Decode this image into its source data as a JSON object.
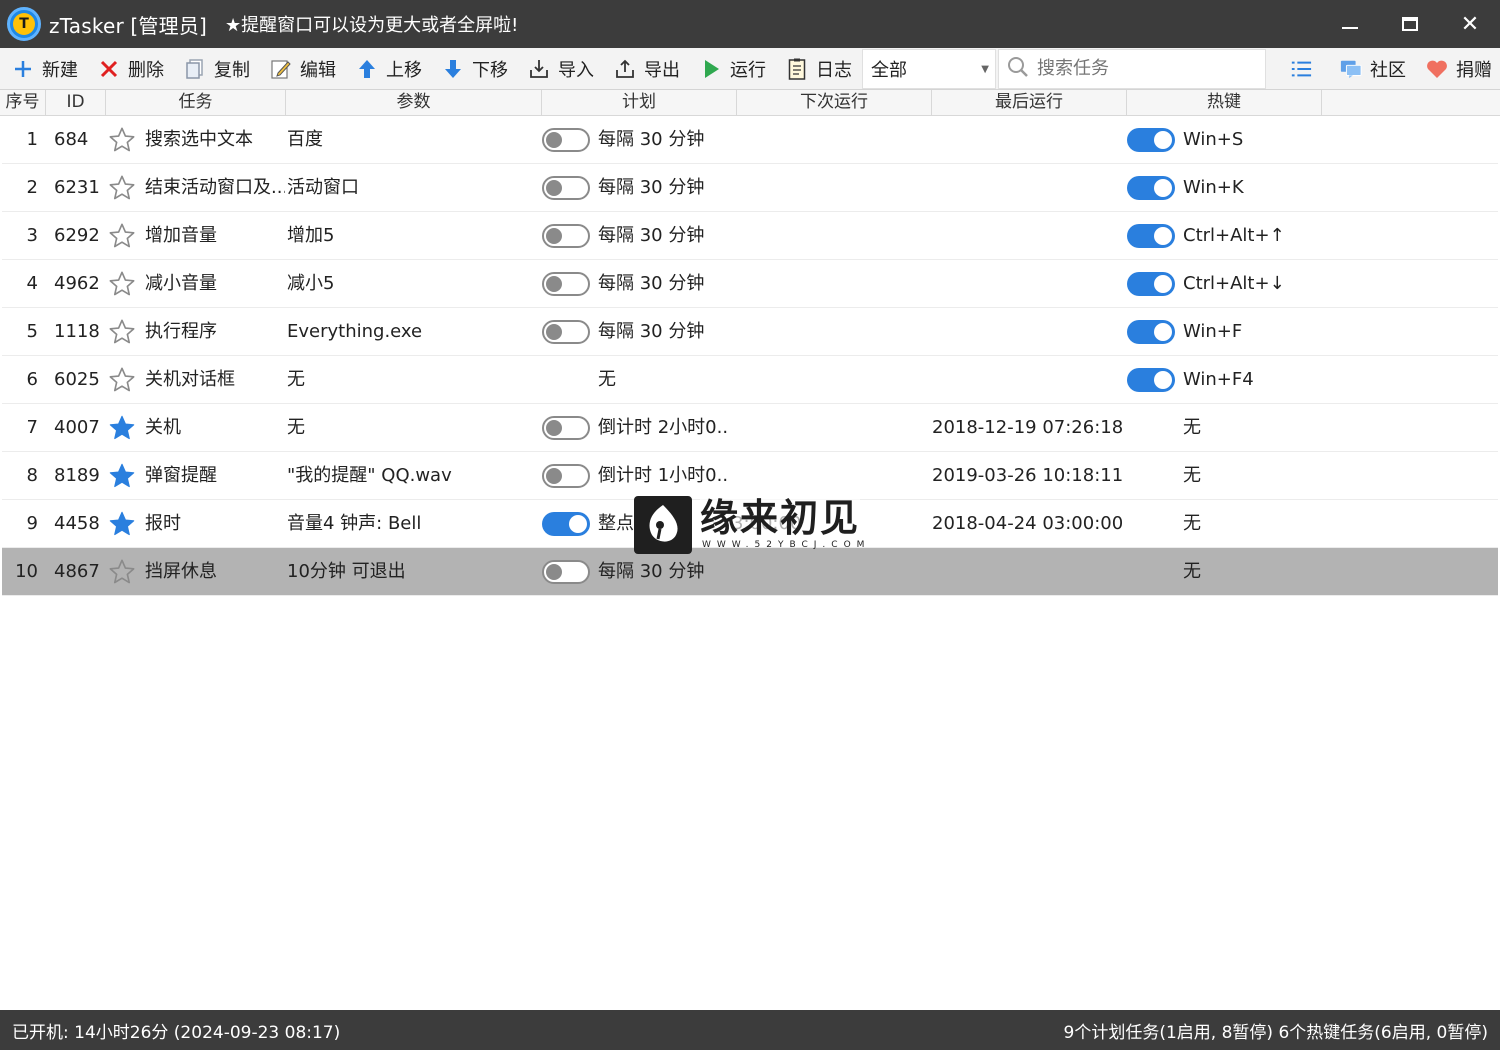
{
  "titlebar": {
    "logo_letter": "T",
    "title": "zTasker [管理员]",
    "notice": "★提醒窗口可以设为更大或者全屏啦!",
    "close_glyph": "✕"
  },
  "toolbar": {
    "new_label": "新建",
    "delete_label": "删除",
    "copy_label": "复制",
    "edit_label": "编辑",
    "move_up_label": "上移",
    "move_down_label": "下移",
    "import_label": "导入",
    "export_label": "导出",
    "run_label": "运行",
    "log_label": "日志",
    "filter_value": "全部",
    "search_placeholder": "搜索任务",
    "community_label": "社区",
    "donate_label": "捐赠"
  },
  "columns": {
    "seq": "序号",
    "id": "ID",
    "task": "任务",
    "param": "参数",
    "plan": "计划",
    "next_run": "下次运行",
    "last_run": "最后运行",
    "hotkey": "热键"
  },
  "rows": [
    {
      "seq": "1",
      "id": "684",
      "starred": false,
      "task": "搜索选中文本",
      "param": "百度",
      "plan_toggle": "off",
      "plan": "每隔 30 分钟",
      "next_run": "",
      "last_run": "",
      "hotkey_toggle": "on",
      "hotkey": "Win+S"
    },
    {
      "seq": "2",
      "id": "6231",
      "starred": false,
      "task": "结束活动窗口及...",
      "param": "活动窗口",
      "plan_toggle": "off",
      "plan": "每隔 30 分钟",
      "next_run": "",
      "last_run": "",
      "hotkey_toggle": "on",
      "hotkey": "Win+K"
    },
    {
      "seq": "3",
      "id": "6292",
      "starred": false,
      "task": "增加音量",
      "param": "增加5",
      "plan_toggle": "off",
      "plan": "每隔 30 分钟",
      "next_run": "",
      "last_run": "",
      "hotkey_toggle": "on",
      "hotkey": "Ctrl+Alt+↑"
    },
    {
      "seq": "4",
      "id": "4962",
      "starred": false,
      "task": "减小音量",
      "param": "减小5",
      "plan_toggle": "off",
      "plan": "每隔 30 分钟",
      "next_run": "",
      "last_run": "",
      "hotkey_toggle": "on",
      "hotkey": "Ctrl+Alt+↓"
    },
    {
      "seq": "5",
      "id": "1118",
      "starred": false,
      "task": "执行程序",
      "param": "Everything.exe",
      "plan_toggle": "off",
      "plan": "每隔 30 分钟",
      "next_run": "",
      "last_run": "",
      "hotkey_toggle": "on",
      "hotkey": "Win+F"
    },
    {
      "seq": "6",
      "id": "6025",
      "starred": false,
      "task": "关机对话框",
      "param": "无",
      "plan_toggle": "none",
      "plan": "无",
      "next_run": "",
      "last_run": "",
      "hotkey_toggle": "on",
      "hotkey": "Win+F4"
    },
    {
      "seq": "7",
      "id": "4007",
      "starred": true,
      "task": "关机",
      "param": "无",
      "plan_toggle": "off",
      "plan": "倒计时 2小时0...",
      "next_run": "",
      "last_run": "2018-12-19 07:26:18",
      "hotkey_toggle": "none",
      "hotkey": "无"
    },
    {
      "seq": "8",
      "id": "8189",
      "starred": true,
      "task": "弹窗提醒",
      "param": "\"我的提醒\" QQ.wav",
      "plan_toggle": "off",
      "plan": "倒计时 1小时0...",
      "next_run": "",
      "last_run": "2019-03-26 10:18:11",
      "hotkey_toggle": "none",
      "hotkey": "无"
    },
    {
      "seq": "9",
      "id": "4458",
      "starred": true,
      "task": "报时",
      "param": "音量4 钟声: Bell",
      "plan_toggle": "on",
      "plan": "整点",
      "next_run": "3:00:00",
      "last_run": "2018-04-24 03:00:00",
      "hotkey_toggle": "none",
      "hotkey": "无"
    },
    {
      "seq": "10",
      "id": "4867",
      "starred": false,
      "task": "挡屏休息",
      "param": "10分钟 可退出",
      "plan_toggle": "off",
      "plan": "每隔 30 分钟",
      "next_run": "",
      "last_run": "",
      "hotkey_toggle": "none",
      "hotkey": "无",
      "selected": true
    }
  ],
  "selected_row": 10,
  "statusbar": {
    "uptime": "已开机: 14小时26分 (2024-09-23 08:17)",
    "summary": "9个计划任务(1启用, 8暂停)  6个热键任务(6启用, 0暂停)"
  },
  "watermark": {
    "text": "缘来初见",
    "sub": "WWW.52YBCJ.COM"
  },
  "colors": {
    "titlebar_bg": "#3c3c3c",
    "toggle_on": "#2a7fde",
    "star_filled": "#2a7fde",
    "selected_row": "#b3b3b3",
    "delete_red": "#e02020",
    "run_green": "#2fa84f"
  },
  "icons": {
    "new": "plus-icon",
    "delete": "x-icon",
    "copy": "copy-icon",
    "edit": "pencil-icon",
    "move_up": "arrow-up-icon",
    "move_down": "arrow-down-icon",
    "import": "import-icon",
    "export": "export-icon",
    "run": "play-icon",
    "log": "log-icon",
    "search": "search-icon",
    "list": "list-icon",
    "community": "chat-icon",
    "donate": "heart-icon"
  }
}
